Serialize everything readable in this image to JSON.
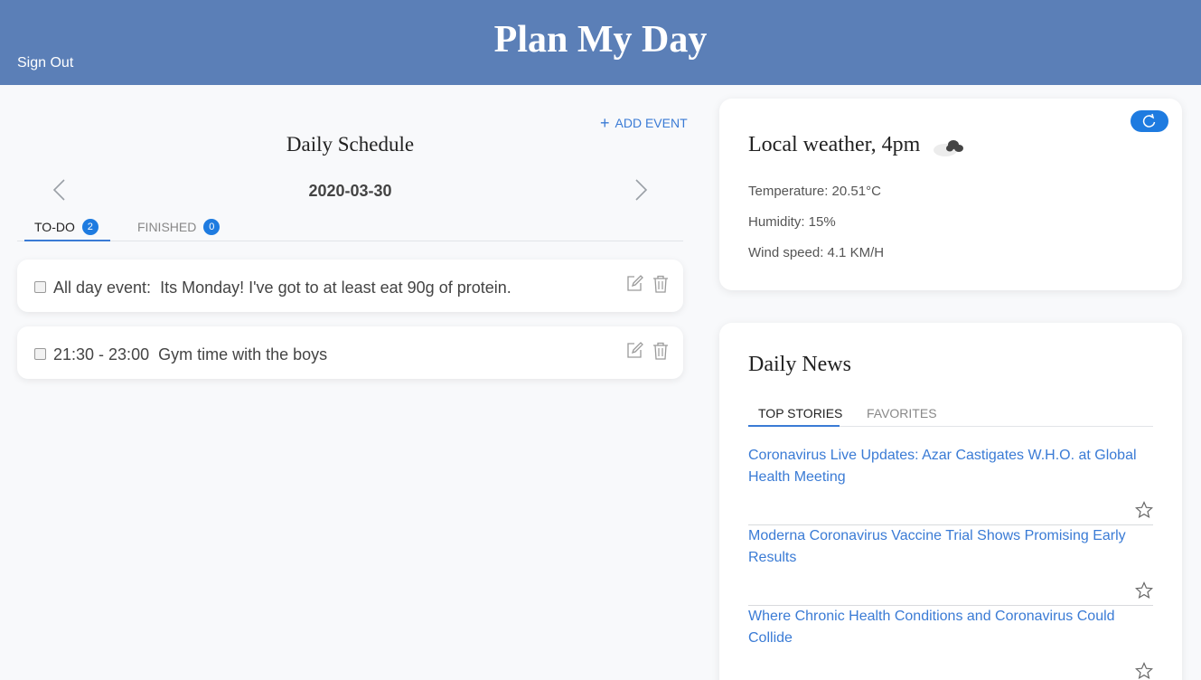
{
  "header": {
    "title": "Plan My Day",
    "sign_out": "Sign Out"
  },
  "schedule": {
    "add_event": "ADD EVENT",
    "title": "Daily Schedule",
    "date": "2020-03-30",
    "tabs": [
      {
        "label": "TO-DO",
        "count": "2"
      },
      {
        "label": "FINISHED",
        "count": "0"
      }
    ],
    "events": [
      {
        "time": "All day event:",
        "description": "Its Monday! I've got to at least eat 90g of protein."
      },
      {
        "time": "21:30 - 23:00",
        "description": "Gym time with the boys"
      }
    ]
  },
  "weather": {
    "title": "Local weather, 4pm",
    "icon": "cloudy-icon",
    "temperature": "Temperature: 20.51°C",
    "humidity": "Humidity: 15%",
    "wind": "Wind speed: 4.1 KM/H"
  },
  "news": {
    "title": "Daily News",
    "tabs": [
      "TOP STORIES",
      "FAVORITES"
    ],
    "items": [
      {
        "headline": "Coronavirus Live Updates: Azar Castigates W.H.O. at Global Health Meeting"
      },
      {
        "headline": "Moderna Coronavirus Vaccine Trial Shows Promising Early Results"
      },
      {
        "headline": "Where Chronic Health Conditions and Coronavirus Could Collide"
      }
    ]
  },
  "colors": {
    "header": "#5b7fb7",
    "accent": "#1e7be0",
    "link": "#3a7bd5"
  }
}
